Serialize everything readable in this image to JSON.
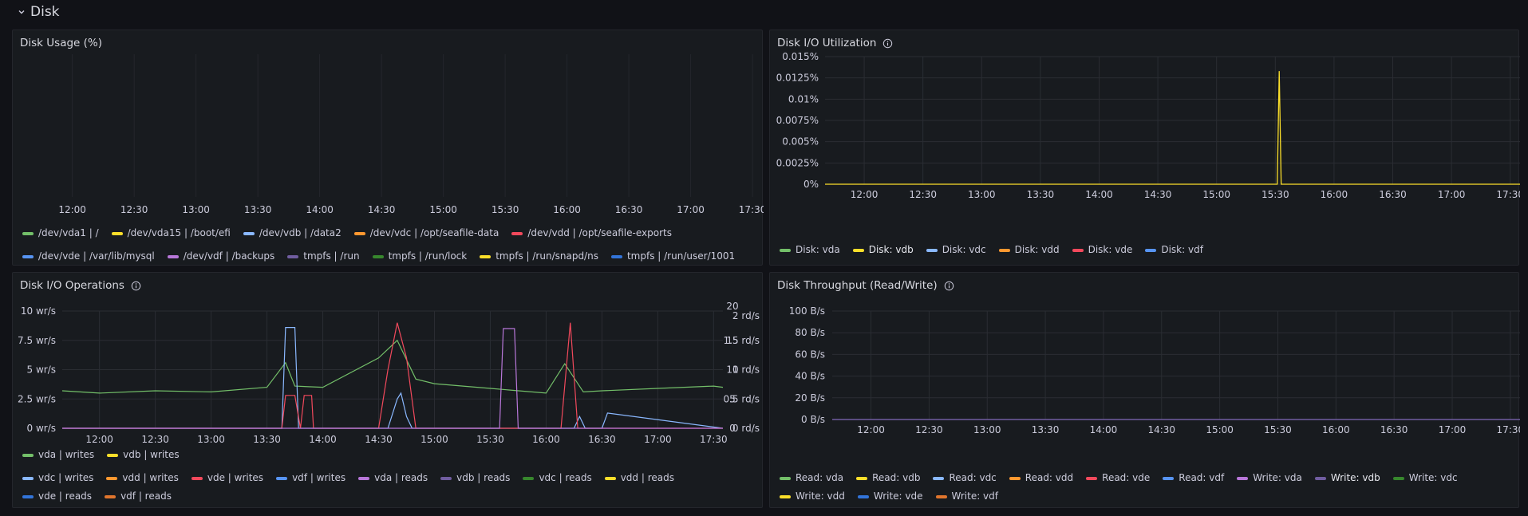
{
  "row": {
    "title": "Disk"
  },
  "time_ticks": [
    "12:00",
    "12:30",
    "13:00",
    "13:30",
    "14:00",
    "14:30",
    "15:00",
    "15:30",
    "16:00",
    "16:30",
    "17:00",
    "17:30"
  ],
  "panels": {
    "usage": {
      "title": "Disk Usage (%)",
      "legend": [
        {
          "label": "/dev/vda1 | /",
          "color": "#73bf69"
        },
        {
          "label": "/dev/vda15 | /boot/efi",
          "color": "#fade2a"
        },
        {
          "label": "/dev/vdb | /data2",
          "color": "#8ab8ff"
        },
        {
          "label": "/dev/vdc | /opt/seafile-data",
          "color": "#ff9830"
        },
        {
          "label": "/dev/vdd | /opt/seafile-exports",
          "color": "#f2495c"
        },
        {
          "label": "/dev/vde | /var/lib/mysql",
          "color": "#5794f2"
        },
        {
          "label": "/dev/vdf | /backups",
          "color": "#b877d9"
        },
        {
          "label": "tmpfs | /run",
          "color": "#705da0"
        },
        {
          "label": "tmpfs | /run/lock",
          "color": "#37872d"
        },
        {
          "label": "tmpfs | /run/snapd/ns",
          "color": "#fade2a"
        },
        {
          "label": "tmpfs | /run/user/1001",
          "color": "#3274d9"
        }
      ]
    },
    "util": {
      "title": "Disk I/O Utilization",
      "y_ticks": [
        "0.015%",
        "0.0125%",
        "0.01%",
        "0.0075%",
        "0.005%",
        "0.0025%",
        "0%"
      ],
      "legend": [
        {
          "label": "Disk: vda",
          "color": "#73bf69"
        },
        {
          "label": "Disk: vdb",
          "color": "#fade2a",
          "bright": true
        },
        {
          "label": "Disk: vdc",
          "color": "#8ab8ff"
        },
        {
          "label": "Disk: vdd",
          "color": "#ff9830"
        },
        {
          "label": "Disk: vde",
          "color": "#f2495c"
        },
        {
          "label": "Disk: vdf",
          "color": "#5794f2"
        }
      ]
    },
    "ops": {
      "title": "Disk I/O Operations",
      "y_ticks_left": [
        "10 wr/s",
        "7.5 wr/s",
        "5 wr/s",
        "2.5 wr/s",
        "0 wr/s"
      ],
      "y_ticks_right": [
        "20",
        "15",
        "10",
        "5",
        "0"
      ],
      "y_ticks_right2": [
        "2 rd/s",
        "1.5 rd/s",
        "1 rd/s",
        "0.5 rd/s",
        "0 rd/s"
      ],
      "legend": [
        {
          "label": "vda | writes",
          "color": "#73bf69"
        },
        {
          "label": "vdb | writes",
          "color": "#fade2a"
        },
        {
          "label": "vdc | writes",
          "color": "#8ab8ff"
        },
        {
          "label": "vdd | writes",
          "color": "#ff9830"
        },
        {
          "label": "vde | writes",
          "color": "#f2495c"
        },
        {
          "label": "vdf | writes",
          "color": "#5794f2"
        },
        {
          "label": "vda | reads",
          "color": "#b877d9"
        },
        {
          "label": "vdb | reads",
          "color": "#705da0"
        },
        {
          "label": "vdc | reads",
          "color": "#37872d"
        },
        {
          "label": "vdd | reads",
          "color": "#fade2a"
        },
        {
          "label": "vde | reads",
          "color": "#3274d9"
        },
        {
          "label": "vdf | reads",
          "color": "#e0752d"
        }
      ]
    },
    "throughput": {
      "title": "Disk Throughput (Read/Write)",
      "y_ticks": [
        "100 B/s",
        "80 B/s",
        "60 B/s",
        "40 B/s",
        "20 B/s",
        "0 B/s"
      ],
      "legend": [
        {
          "label": "Read: vda",
          "color": "#73bf69"
        },
        {
          "label": "Read: vdb",
          "color": "#fade2a"
        },
        {
          "label": "Read: vdc",
          "color": "#8ab8ff"
        },
        {
          "label": "Read: vdd",
          "color": "#ff9830"
        },
        {
          "label": "Read: vde",
          "color": "#f2495c"
        },
        {
          "label": "Read: vdf",
          "color": "#5794f2"
        },
        {
          "label": "Write: vda",
          "color": "#b877d9"
        },
        {
          "label": "Write: vdb",
          "color": "#705da0",
          "bright": true
        },
        {
          "label": "Write: vdc",
          "color": "#37872d"
        },
        {
          "label": "Write: vdd",
          "color": "#fade2a"
        },
        {
          "label": "Write: vde",
          "color": "#3274d9"
        },
        {
          "label": "Write: vdf",
          "color": "#e0752d"
        }
      ]
    }
  },
  "chart_data": [
    {
      "type": "line",
      "title": "Disk I/O Utilization",
      "ylim": [
        0,
        0.015
      ],
      "series": [
        {
          "name": "Disk: vdb",
          "x": [
            "11:40",
            "15:31",
            "15:32",
            "15:33",
            "17:35"
          ],
          "values": [
            0,
            0,
            0.0133,
            0,
            0
          ]
        }
      ]
    },
    {
      "type": "line",
      "title": "Disk I/O Operations",
      "ylim": [
        0,
        10
      ],
      "series": [
        {
          "name": "vda | writes",
          "x": [
            "11:40",
            "12:00",
            "12:30",
            "13:00",
            "13:30",
            "13:40",
            "13:45",
            "14:00",
            "14:30",
            "14:40",
            "14:50",
            "15:00",
            "15:30",
            "16:00",
            "16:10",
            "16:20",
            "16:30",
            "17:00",
            "17:30",
            "17:35"
          ],
          "values": [
            3.2,
            3.0,
            3.2,
            3.1,
            3.5,
            5.6,
            3.6,
            3.5,
            6.0,
            7.5,
            4.2,
            3.8,
            3.4,
            3.0,
            5.5,
            3.1,
            3.2,
            3.4,
            3.6,
            3.5
          ]
        },
        {
          "name": "vdc | writes",
          "x": [
            "11:40",
            "13:38",
            "13:40",
            "13:45",
            "13:47",
            "14:35",
            "14:40",
            "14:42",
            "14:45",
            "14:48",
            "16:15",
            "16:18",
            "16:21",
            "16:30",
            "16:33",
            "17:35"
          ],
          "values": [
            0,
            0,
            8.6,
            8.6,
            0,
            0,
            2.5,
            3.0,
            1.0,
            0,
            0,
            1.0,
            0,
            0,
            1.3,
            0
          ]
        },
        {
          "name": "vde | writes",
          "x": [
            "11:40",
            "13:38",
            "13:40",
            "13:45",
            "13:48",
            "13:50",
            "13:54",
            "13:55",
            "14:30",
            "14:35",
            "14:40",
            "14:45",
            "14:50",
            "16:08",
            "16:13",
            "16:17",
            "17:35"
          ],
          "values": [
            0,
            0,
            2.8,
            2.8,
            0,
            2.8,
            2.8,
            0,
            0,
            5.0,
            9.0,
            6.0,
            0,
            0,
            9.0,
            0,
            0
          ]
        },
        {
          "name": "vda | reads",
          "x": [
            "11:40",
            "15:35",
            "15:37",
            "15:43",
            "15:45",
            "17:35"
          ],
          "values": [
            0,
            0,
            1.7,
            1.7,
            0,
            0
          ]
        }
      ]
    },
    {
      "type": "line",
      "title": "Disk Throughput (Read/Write)",
      "ylim": [
        0,
        100
      ],
      "series": [
        {
          "name": "Write: vdb",
          "x": [
            "11:40",
            "17:35"
          ],
          "values": [
            0,
            0
          ]
        }
      ]
    }
  ]
}
